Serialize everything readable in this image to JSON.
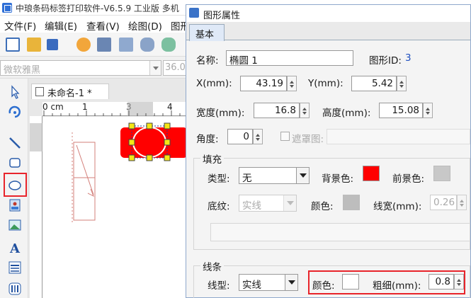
{
  "app": {
    "title": "中琅条码标签打印软件-V6.5.9 工业版 多机",
    "menu": [
      "文件(F)",
      "编辑(E)",
      "查看(V)",
      "绘图(D)",
      "图形"
    ],
    "font_name": "微软雅黑",
    "font_size": "36.0",
    "doc_tab": "未命名-1 *",
    "ruler_unit": "0 cm",
    "ruler_ticks": [
      "1",
      "2",
      "3",
      "4"
    ],
    "colors": {
      "accent_red": "#e8242b",
      "shape_fill": "#ff0000",
      "selection": "#f5e614"
    }
  },
  "dialog": {
    "title": "图形属性",
    "tab": "基本",
    "name_label": "名称:",
    "name_value": "椭圆 1",
    "shape_id_label": "图形ID:",
    "shape_id_value": "3",
    "x_label": "X(mm):",
    "x_value": "43.19",
    "y_label": "Y(mm):",
    "y_value": "5.42",
    "width_label": "宽度(mm):",
    "width_value": "16.8",
    "height_label": "高度(mm):",
    "height_value": "15.08",
    "angle_label": "角度:",
    "angle_value": "0",
    "mask_label": "遮罩图:",
    "fill": {
      "group_title": "填充",
      "type_label": "类型:",
      "type_value": "无",
      "bg_label": "背景色:",
      "fg_label": "前景色:",
      "pattern_label": "底纹:",
      "pattern_value": "实线",
      "color_label": "颜色:",
      "linewidth_label": "线宽(mm):",
      "linewidth_value": "0.26"
    },
    "line": {
      "group_title": "线条",
      "type_label": "线型:",
      "type_value": "实线",
      "color_label": "颜色:",
      "thickness_label": "粗细(mm):",
      "thickness_value": "0.8"
    }
  }
}
